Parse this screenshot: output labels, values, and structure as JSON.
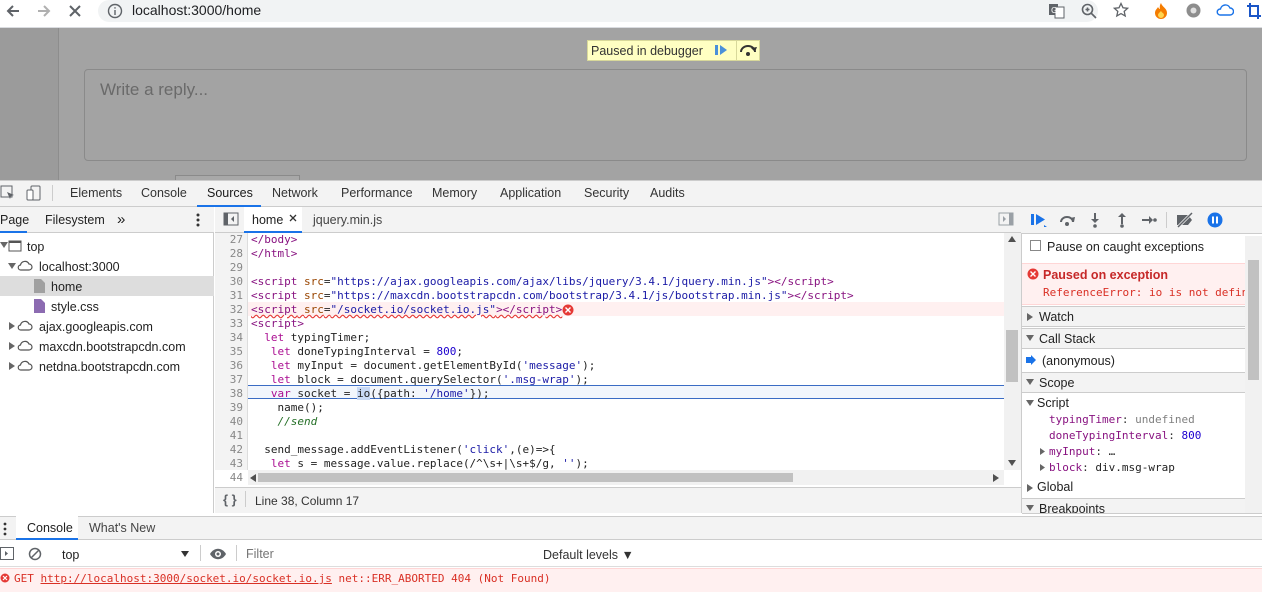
{
  "browser": {
    "url": "localhost:3000/home"
  },
  "page": {
    "reply_placeholder": "Write a reply...",
    "debugger_banner": "Paused in debugger"
  },
  "devtools": {
    "tabs": [
      "Elements",
      "Console",
      "Sources",
      "Network",
      "Performance",
      "Memory",
      "Application",
      "Security",
      "Audits"
    ],
    "active_tab": "Sources",
    "navigator": {
      "tabs": [
        "Page",
        "Filesystem"
      ],
      "more": "»",
      "tree": [
        {
          "label": "top",
          "depth": 0,
          "icon": "frame-icon"
        },
        {
          "label": "localhost:3000",
          "depth": 1,
          "icon": "cloud-icon"
        },
        {
          "label": "home",
          "depth": 2,
          "icon": "file-icon"
        },
        {
          "label": "style.css",
          "depth": 2,
          "icon": "file-icon"
        },
        {
          "label": "ajax.googleapis.com",
          "depth": 1,
          "icon": "cloud-icon"
        },
        {
          "label": "maxcdn.bootstrapcdn.com",
          "depth": 1,
          "icon": "cloud-icon"
        },
        {
          "label": "netdna.bootstrapcdn.com",
          "depth": 1,
          "icon": "cloud-icon"
        }
      ]
    },
    "editor": {
      "tabs": [
        {
          "label": "home",
          "closable": true,
          "active": true
        },
        {
          "label": "jquery.min.js",
          "closable": false,
          "active": false
        }
      ],
      "line_numbers": [
        "27",
        "28",
        "29",
        "30",
        "31",
        "32",
        "33",
        "34",
        "35",
        "36",
        "37",
        "38",
        "39",
        "40",
        "41",
        "42",
        "43",
        "44"
      ],
      "status": "Line 38, Column 17",
      "pretty_print": "{ }"
    },
    "debugger": {
      "pause_on_caught": "Pause on caught exceptions",
      "exception_title": "Paused on exception",
      "exception_message": "ReferenceError: io is not defined",
      "sections": {
        "watch": "Watch",
        "call_stack": "Call Stack",
        "scope": "Scope",
        "script": "Script",
        "global": "Global",
        "breakpoints": "Breakpoints"
      },
      "call_stack_frame": "(anonymous)",
      "scope_vars": [
        {
          "name": "typingTimer",
          "value": "undefined"
        },
        {
          "name": "doneTypingInterval",
          "value": "800"
        },
        {
          "name": "myInput",
          "value": "…"
        },
        {
          "name": "block",
          "value": "div.msg-wrap"
        }
      ]
    },
    "console": {
      "tabs": [
        "Console",
        "What's New"
      ],
      "context": "top",
      "filter_placeholder": "Filter",
      "levels": "Default levels ▼",
      "error": {
        "method": "GET",
        "url": "http://localhost:3000/socket.io/socket.io.js",
        "message": "net::ERR_ABORTED 404 (Not Found)"
      }
    }
  },
  "colors": {
    "accent": "#1a73e8",
    "error": "#d93025",
    "banner": "#ffffc2"
  }
}
